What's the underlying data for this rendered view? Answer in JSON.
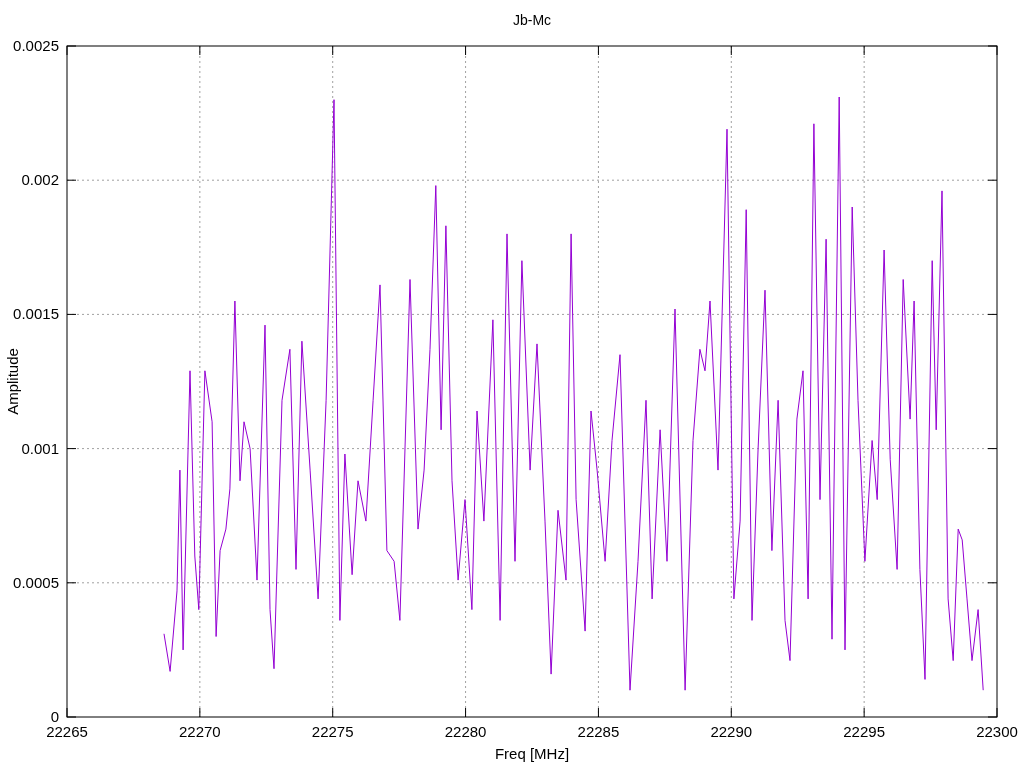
{
  "chart_data": {
    "type": "line",
    "title": "Jb-Mc",
    "xlabel": "Freq [MHz]",
    "ylabel": "Amplitude",
    "grid": true,
    "xlim": [
      22265,
      22300
    ],
    "ylim": [
      0,
      0.0025
    ],
    "xticks": [
      22265,
      22270,
      22275,
      22280,
      22285,
      22290,
      22295,
      22300
    ],
    "yticks": [
      {
        "value": 0,
        "label": "0"
      },
      {
        "value": 0.0005,
        "label": "0.0005"
      },
      {
        "value": 0.001,
        "label": "0.001"
      },
      {
        "value": 0.0015,
        "label": "0.0015"
      },
      {
        "value": 0.002,
        "label": "0.002"
      },
      {
        "value": 0.0025,
        "label": "0.0025"
      }
    ],
    "x": [
      22268.65,
      22268.88,
      22269.14,
      22269.25,
      22269.37,
      22269.63,
      22269.81,
      22269.96,
      22270.19,
      22270.46,
      22270.61,
      22270.76,
      22270.98,
      22271.13,
      22271.32,
      22271.51,
      22271.66,
      22271.89,
      22272.15,
      22272.45,
      22272.64,
      22272.79,
      22273.09,
      22273.39,
      22273.62,
      22273.84,
      22274.15,
      22274.45,
      22274.75,
      22275.05,
      22275.27,
      22275.46,
      22275.73,
      22275.95,
      22276.25,
      22276.52,
      22276.78,
      22277.04,
      22277.31,
      22277.53,
      22277.91,
      22278.21,
      22278.44,
      22278.66,
      22278.88,
      22279.08,
      22279.26,
      22279.49,
      22279.72,
      22279.98,
      22280.24,
      22280.43,
      22280.69,
      22281.03,
      22281.3,
      22281.56,
      22281.86,
      22282.12,
      22282.43,
      22282.69,
      22282.99,
      22283.22,
      22283.48,
      22283.78,
      22283.97,
      22284.16,
      22284.5,
      22284.72,
      22284.95,
      22285.25,
      22285.51,
      22285.81,
      22286.19,
      22286.49,
      22286.79,
      22287.02,
      22287.32,
      22287.58,
      22287.88,
      22288.26,
      22288.56,
      22288.82,
      22289.01,
      22289.2,
      22289.5,
      22289.84,
      22290.1,
      22290.33,
      22290.56,
      22290.78,
      22291.01,
      22291.27,
      22291.53,
      22291.76,
      22292.02,
      22292.21,
      22292.47,
      22292.7,
      22292.89,
      22293.11,
      22293.34,
      22293.57,
      22293.79,
      22294.06,
      22294.28,
      22294.55,
      22294.77,
      22295.03,
      22295.3,
      22295.49,
      22295.75,
      22295.98,
      22296.24,
      22296.47,
      22296.73,
      22296.88,
      22297.1,
      22297.29,
      22297.56,
      22297.71,
      22297.93,
      22298.16,
      22298.35,
      22298.54,
      22298.69,
      22298.87,
      22299.06,
      22299.29,
      22299.48
    ],
    "series": [
      {
        "color": "#9400d3",
        "values": [
          0.00031,
          0.00017,
          0.00047,
          0.00092,
          0.00025,
          0.00129,
          0.0006,
          0.0004,
          0.00129,
          0.0011,
          0.0003,
          0.00062,
          0.0007,
          0.00085,
          0.00155,
          0.00088,
          0.0011,
          0.001,
          0.00051,
          0.00146,
          0.0004,
          0.00018,
          0.00118,
          0.00137,
          0.00055,
          0.0014,
          0.00092,
          0.00044,
          0.00118,
          0.0023,
          0.00036,
          0.00098,
          0.00053,
          0.00088,
          0.00073,
          0.00118,
          0.00161,
          0.00062,
          0.00058,
          0.00036,
          0.00163,
          0.0007,
          0.00092,
          0.00137,
          0.00198,
          0.00107,
          0.00183,
          0.00088,
          0.00051,
          0.00081,
          0.0004,
          0.00114,
          0.00073,
          0.00148,
          0.00036,
          0.0018,
          0.00058,
          0.0017,
          0.00092,
          0.00139,
          0.00073,
          0.00016,
          0.00077,
          0.00051,
          0.0018,
          0.00081,
          0.00032,
          0.00114,
          0.00092,
          0.00058,
          0.00103,
          0.00135,
          0.0001,
          0.00058,
          0.00118,
          0.00044,
          0.00107,
          0.00058,
          0.00152,
          0.0001,
          0.00103,
          0.00137,
          0.00129,
          0.00155,
          0.00092,
          0.00219,
          0.00044,
          0.00073,
          0.00189,
          0.00036,
          0.001,
          0.00159,
          0.00062,
          0.00118,
          0.00036,
          0.00021,
          0.00111,
          0.00129,
          0.00044,
          0.00221,
          0.00081,
          0.00178,
          0.00029,
          0.00231,
          0.00025,
          0.0019,
          0.00118,
          0.00058,
          0.00103,
          0.00081,
          0.00174,
          0.00096,
          0.00055,
          0.00163,
          0.00111,
          0.00155,
          0.00055,
          0.00014,
          0.0017,
          0.00107,
          0.00196,
          0.00044,
          0.00021,
          0.0007,
          0.00066,
          0.00044,
          0.00021,
          0.0004,
          0.0001
        ]
      }
    ]
  }
}
